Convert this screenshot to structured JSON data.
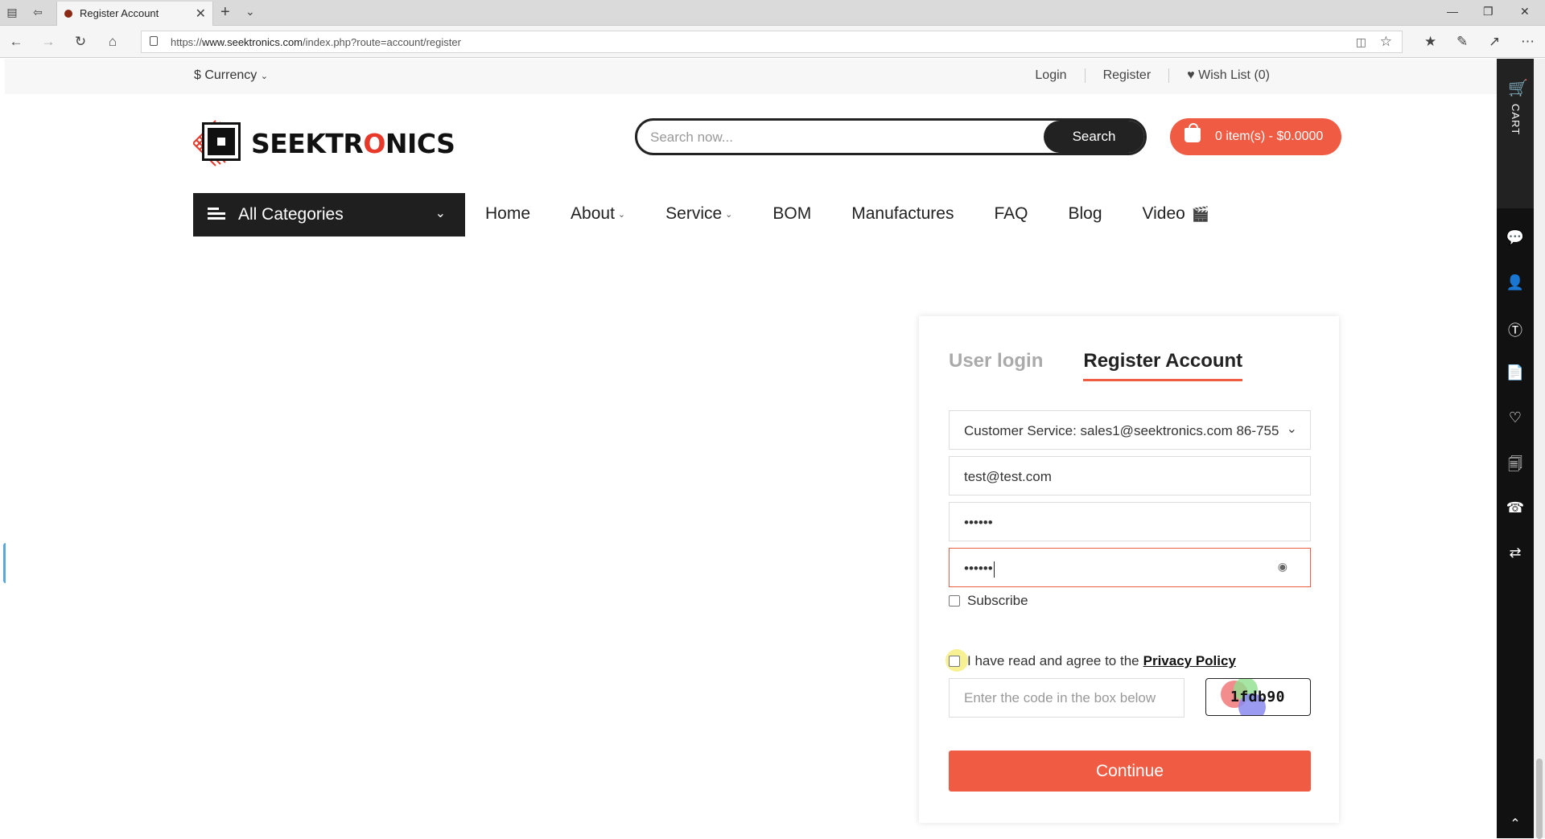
{
  "browser": {
    "tab_title": "Register Account",
    "url_prefix": "https://",
    "url_domain": "www.seektronics.com",
    "url_path": "/index.php?route=account/register"
  },
  "topbar": {
    "currency": "$ Currency",
    "login": "Login",
    "register": "Register",
    "wishlist": "Wish List (0)"
  },
  "header": {
    "logo_text_1": "SEEKTR",
    "logo_text_o": "O",
    "logo_text_2": "NICS",
    "search_placeholder": "Search now...",
    "search_button": "Search",
    "cart_summary": "0 item(s) - $0.0000"
  },
  "nav": {
    "all_categories": "All Categories",
    "items": [
      "Home",
      "About",
      "Service",
      "BOM",
      "Manufactures",
      "FAQ",
      "Blog",
      "Video"
    ]
  },
  "sidebar": {
    "cart_label": "CART"
  },
  "form": {
    "tab_login": "User login",
    "tab_register": "Register Account",
    "service_select": "Customer Service: sales1@seektronics.com 86-755",
    "email_value": "test@test.com",
    "password_value": "••••••",
    "confirm_value": "••••••",
    "subscribe_label": "Subscribe",
    "agree_label": "I have read and agree to the",
    "privacy_link": "Privacy Policy",
    "captcha_placeholder": "Enter the code in the box below",
    "captcha_code": "1fdb90",
    "continue_button": "Continue"
  },
  "colors": {
    "accent": "#f05b43",
    "dark": "#1f1f1f"
  }
}
